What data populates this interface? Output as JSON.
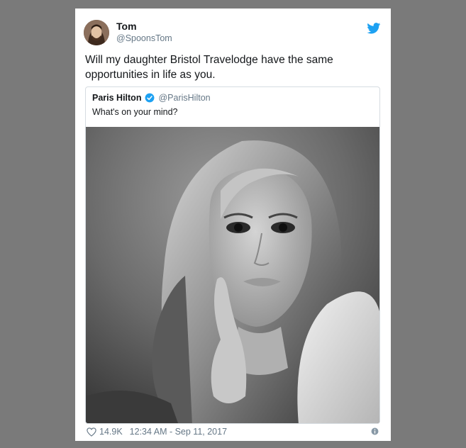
{
  "tweet": {
    "display_name": "Tom",
    "handle": "@SpoonsTom",
    "text": "Will my daughter Bristol Travelodge have the same opportunities in life as you.",
    "brand_icon": "twitter-bird-icon",
    "brand_color": "#1da1f2"
  },
  "quoted_tweet": {
    "display_name": "Paris Hilton",
    "handle": "@ParisHilton",
    "text": "What's on your mind?",
    "verified_icon": "verified-badge-icon",
    "verified_color": "#1da1f2",
    "media": "black-and-white portrait photo"
  },
  "footer": {
    "likes": "14.9K",
    "timestamp": "12:34 AM - Sep 11, 2017",
    "like_icon": "heart-outline-icon",
    "info_icon": "info-icon"
  }
}
